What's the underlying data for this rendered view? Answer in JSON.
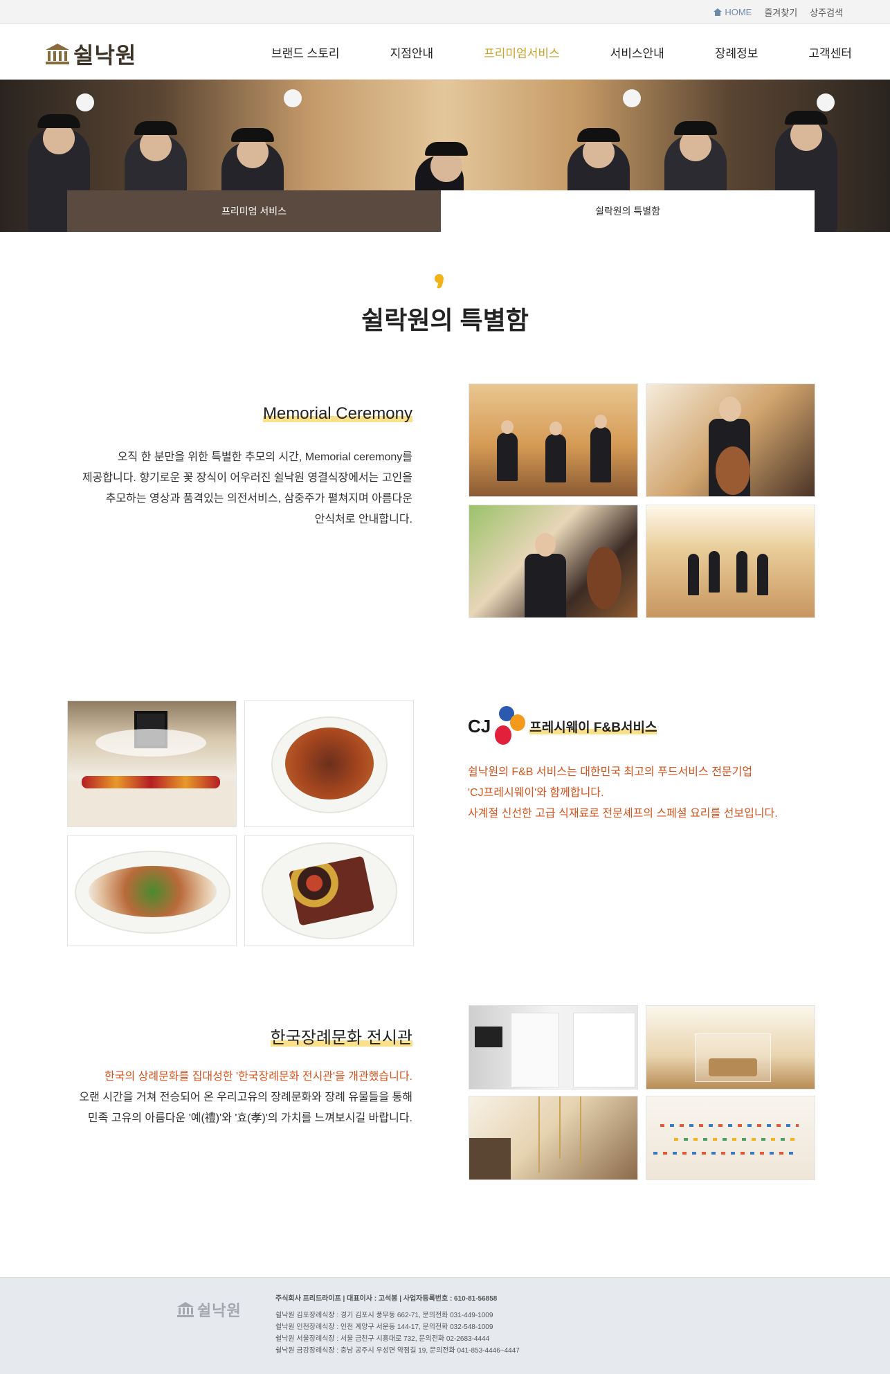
{
  "topbar": {
    "home": "HOME",
    "favorites": "즐겨찾기",
    "mourner_search": "상주검색"
  },
  "header": {
    "logo": "쉴낙원",
    "nav": [
      "브랜드 스토리",
      "지점안내",
      "프리미엄서비스",
      "서비스안내",
      "장례정보",
      "고객센터"
    ],
    "active_nav": "프리미엄서비스"
  },
  "hero": {
    "tabs": [
      "프리미엄 서비스",
      "쉴락원의 특별함"
    ]
  },
  "section": {
    "title": "쉴락원의 특별함"
  },
  "memorial": {
    "heading": "Memorial Ceremony",
    "lines": [
      "오직 한 분만을 위한 특별한 추모의 시간, Memorial ceremony를",
      "제공합니다. 향기로운 꽃 장식이 어우러진 쉴낙원 영결식장에서는 고인을",
      "추모하는 영상과 품격있는 의전서비스, 삼중주가 펼쳐지며 아름다운",
      "안식처로 안내합니다."
    ]
  },
  "fnb": {
    "brand_letters": "CJ",
    "heading": "프레시웨이 F&B서비스",
    "lines": [
      "쉴낙원의 F&B 서비스는 대한민국 최고의 푸드서비스 전문기업",
      "'CJ프레시웨이'와 함께합니다.",
      "사계절 신선한 고급 식재료로 전문셰프의 스페셜 요리를 선보입니다."
    ]
  },
  "museum": {
    "heading": "한국장례문화 전시관",
    "lines": [
      "한국의 상례문화를 집대성한 '한국장례문화 전시관'을 개관했습니다.",
      "오랜 시간을 거쳐 전승되어 온 우리고유의 장례문화와 장례 유물들을 통해",
      "민족 고유의 아름다운 '예(禮)'와 '효(孝)'의 가치를 느껴보시길 바랍니다."
    ]
  },
  "footer": {
    "logo": "쉴낙원",
    "company": "주식회사 프리드라이프   |   대표이사 : 고석봉   |   사업자등록번호 : 610-81-56858",
    "branches": [
      "쉴낙원 김포장례식장  :  경기 김포시 풍무동 662-71,  문의전화 031-449-1009",
      "쉴낙원 인천장례식장  :  인천 계양구 서운동 144-17,  문의전화 032-548-1009",
      "쉴낙원 서울장례식장  :  서울 금천구 시흥대로 732,  문의전화 02-2683-4444",
      "쉴낙원 금강장례식장  :  충남 공주시 우성면 약점길 19,  문의전화 041-853-4446~4447"
    ]
  },
  "colors": {
    "accent": "#c9a12a",
    "highlight": "#fbe08a",
    "orange_text": "#d4531c",
    "tab_dark": "#5a4a3f",
    "footer_bg": "#e6e9ee"
  }
}
